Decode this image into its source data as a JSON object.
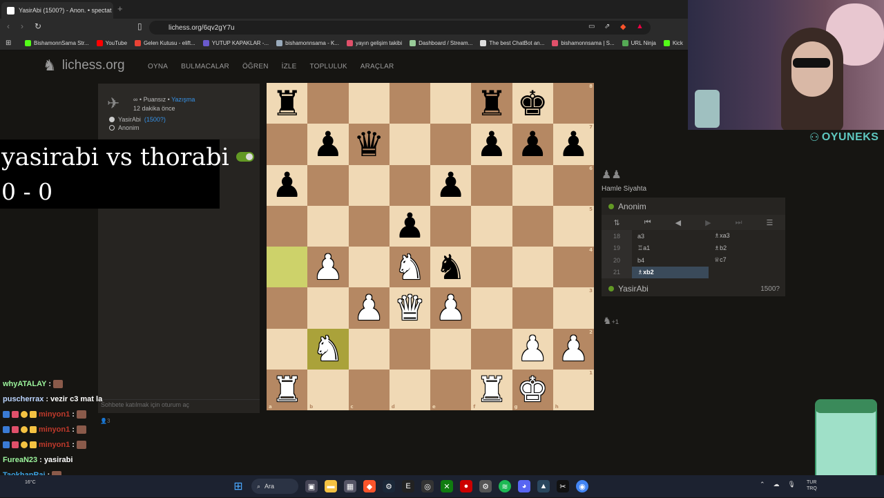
{
  "browser": {
    "tab_title": "YasirAbi (1500?) - Anon. • spectat",
    "url": "lichess.org/6qv2gY7u",
    "bookmarks": [
      {
        "label": "BishamonnSama Str...",
        "color": "#53fc18"
      },
      {
        "label": "YouTube",
        "color": "#ff0000"
      },
      {
        "label": "Gelen Kutusu - elift...",
        "color": "#ea4335"
      },
      {
        "label": "YUTUP KAPAKLAR -...",
        "color": "#6a5acd"
      },
      {
        "label": "bishamonnsama - K...",
        "color": "#9ab"
      },
      {
        "label": "yayın gelişim takibi",
        "color": "#e0506a"
      },
      {
        "label": "Dashboard / Stream...",
        "color": "#9c9"
      },
      {
        "label": "The best ChatBot an...",
        "color": "#ddd"
      },
      {
        "label": "bishamonnsama | S...",
        "color": "#e0506a"
      },
      {
        "label": "URL Ninja",
        "color": "#5a5"
      },
      {
        "label": "Kick",
        "color": "#53fc18"
      }
    ]
  },
  "lichess": {
    "logo_text": "lichess.org",
    "nav": [
      "OYNA",
      "BULMACALAR",
      "ÖĞREN",
      "İZLE",
      "TOPLULUK",
      "ARAÇLAR"
    ]
  },
  "game_info": {
    "mode": "∞ • Puansız • ",
    "mode_link": "Yazışma",
    "time_ago": "12 dakika önce",
    "white_player": "YasirAbi",
    "white_rating": "(1500?)",
    "black_player": "Anonim",
    "chat_placeholder": "Sohbete katılmak için oturum aç",
    "spectators": "3"
  },
  "overlay": {
    "matchup": "yasirabi vs thorabi",
    "score": "0 - 0"
  },
  "board": {
    "rows": [
      [
        "r",
        "",
        "",
        "",
        "",
        "r",
        "k",
        ""
      ],
      [
        "",
        "p",
        "q",
        "",
        "",
        "p",
        "p",
        "p"
      ],
      [
        "p",
        "",
        "",
        "",
        "p",
        "",
        "",
        ""
      ],
      [
        "",
        "",
        "",
        "p",
        "",
        "",
        "",
        ""
      ],
      [
        "",
        "P",
        "",
        "N",
        "n",
        "",
        "",
        ""
      ],
      [
        "",
        "",
        "P",
        "Q",
        "P",
        "",
        "",
        ""
      ],
      [
        "",
        "N",
        "",
        "",
        "",
        "",
        "P",
        "P"
      ],
      [
        "R",
        "",
        "",
        "",
        "",
        "R",
        "K",
        ""
      ]
    ],
    "highlight": [
      "4-0",
      "6-1"
    ],
    "files": [
      "a",
      "b",
      "c",
      "d",
      "e",
      "f",
      "g",
      "h"
    ],
    "ranks": [
      "8",
      "7",
      "6",
      "5",
      "4",
      "3",
      "2",
      "1"
    ]
  },
  "move_panel": {
    "status": "Hamle Siyahta",
    "opponent": "Anonim",
    "player": "YasirAbi",
    "player_rating": "1500?",
    "moves": [
      {
        "no": "18",
        "white": "a3",
        "black": "♗xa3"
      },
      {
        "no": "19",
        "white": "♖a1",
        "black": "♗b2"
      },
      {
        "no": "20",
        "white": "b4",
        "black": "♕c7"
      },
      {
        "no": "21",
        "white": "♗xb2",
        "black": ""
      }
    ],
    "plus": "+1"
  },
  "stream": {
    "brand": "OYUNEKS",
    "chat": [
      {
        "user": "whyATALAY",
        "msg": "",
        "color": "#9df59d"
      },
      {
        "user": "puscherrax",
        "msg": "vezir c3 mat la",
        "color": "#bcd5ff"
      },
      {
        "user": "minyon1",
        "msg": "",
        "color": "#c0392b"
      },
      {
        "user": "minyon1",
        "msg": "",
        "color": "#c0392b"
      },
      {
        "user": "minyon1",
        "msg": "",
        "color": "#c0392b"
      },
      {
        "user": "FureaN23",
        "msg": "yasirabi",
        "color": "#9df59d"
      },
      {
        "user": "TaokhanRai",
        "msg": "",
        "color": "#3ba4e6"
      },
      {
        "user": "hyATALAY",
        "msg": "",
        "color": "#9df59d"
      }
    ]
  },
  "taskbar": {
    "search": "Ara",
    "weather": "16°C",
    "lang1": "TUR",
    "lang2": "TRQ"
  }
}
